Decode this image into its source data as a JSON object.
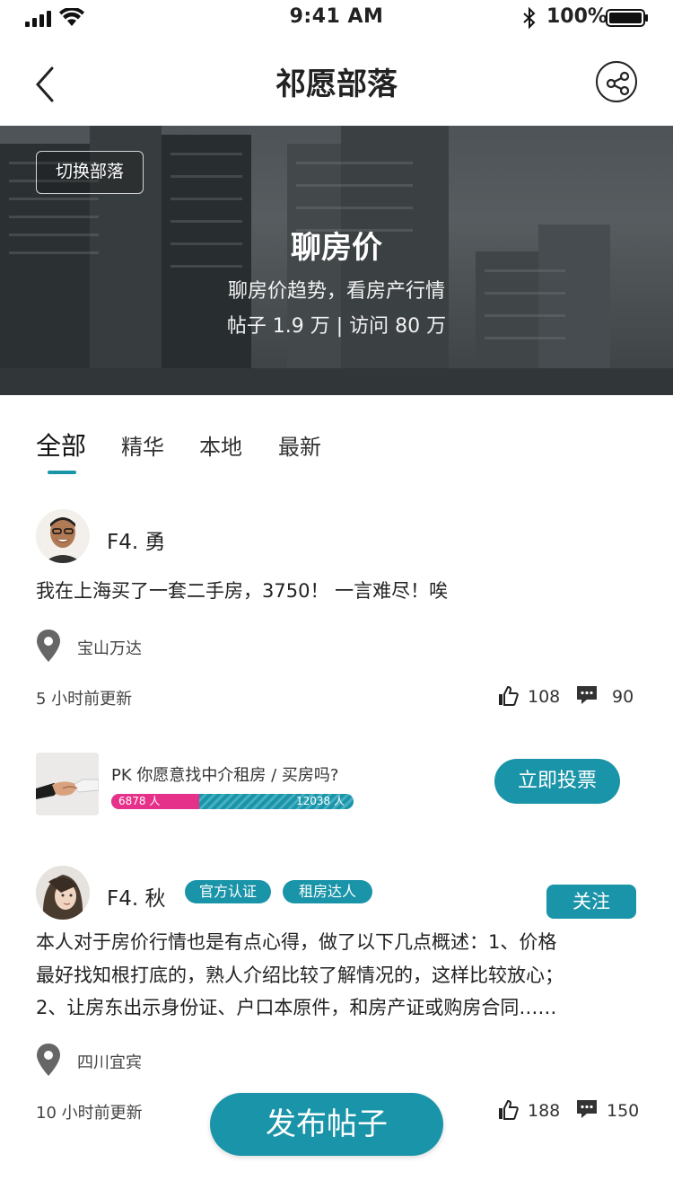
{
  "status_bar": {
    "time": "9:41 AM",
    "battery": "100%"
  },
  "nav": {
    "title": "祁愿部落",
    "back_icon": "chevron-left-icon",
    "share_icon": "share-icon"
  },
  "banner": {
    "switch_label": "切换部落",
    "title": "聊房价",
    "subtitle": "聊房价趋势，看房产行情",
    "stats": "帖子 1.9 万 | 访问 80 万"
  },
  "tabs": [
    {
      "label": "全部",
      "active": true
    },
    {
      "label": "精华",
      "active": false
    },
    {
      "label": "本地",
      "active": false
    },
    {
      "label": "最新",
      "active": false
    }
  ],
  "posts": [
    {
      "username": "F4. 勇",
      "lines": [
        "我在上海买了一套二手房，3750！ 一言难尽！唉"
      ],
      "location": "宝山万达",
      "time": "5 小时前更新",
      "likes": "108",
      "comments": "90"
    },
    {
      "username": "F4. 秋",
      "badges": [
        "官方认证",
        "租房达人"
      ],
      "follow_label": "关注",
      "lines": [
        "本人对于房价行情也是有点心得，做了以下几点概述：1、价格",
        "最好找知根打底的，熟人介绍比较了解情况的，这样比较放心；",
        "2、让房东出示身份证、户口本原件，和房产证或购房合同……"
      ],
      "location": "四川宜宾",
      "time": "10 小时前更新",
      "likes": "188",
      "comments": "150"
    }
  ],
  "pk": {
    "question": "PK 你愿意找中介租房 / 买房吗?",
    "left_label": "6878 人",
    "right_label": "12038 人",
    "left_count": 6878,
    "right_count": 12038,
    "vote_label": "立即投票"
  },
  "publish_label": "发布帖子",
  "colors": {
    "accent": "#1a94a8",
    "pk_pink": "#e6318a"
  }
}
